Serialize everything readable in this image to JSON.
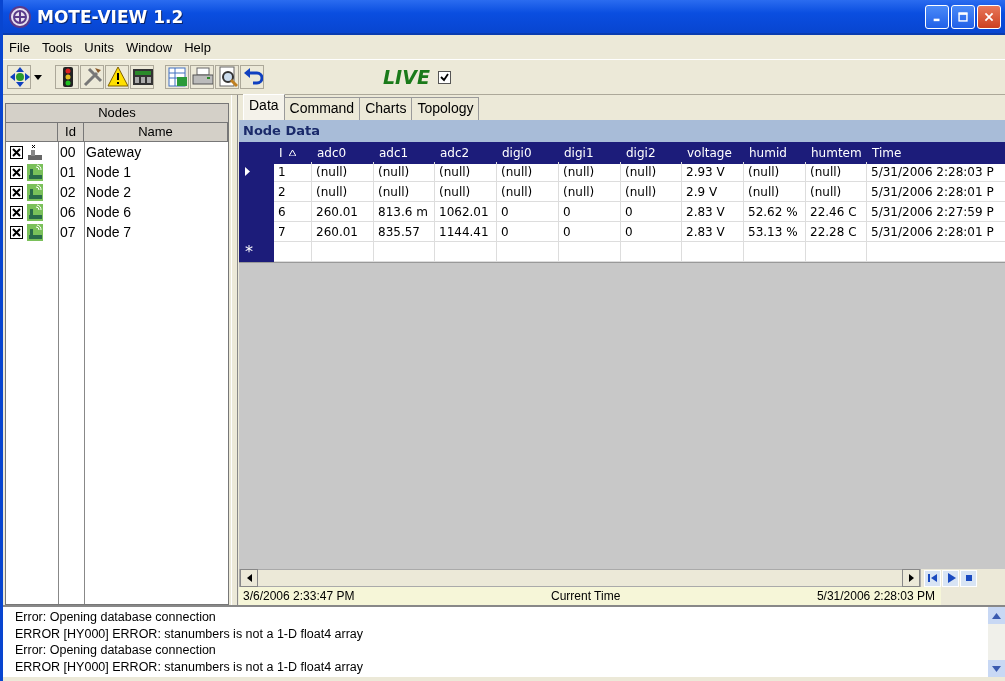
{
  "window": {
    "title": "MOTE-VIEW 1.2"
  },
  "menu": [
    "File",
    "Tools",
    "Units",
    "Window",
    "Help"
  ],
  "toolbar": {
    "live_label": "LIVE",
    "live_checked": true
  },
  "nodes": {
    "title": "Nodes",
    "columns": [
      "Id",
      "Name"
    ],
    "items": [
      {
        "id": "00",
        "name": "Gateway",
        "checked": true,
        "kind": "gateway"
      },
      {
        "id": "01",
        "name": "Node 1",
        "checked": true,
        "kind": "mote"
      },
      {
        "id": "02",
        "name": "Node 2",
        "checked": true,
        "kind": "mote"
      },
      {
        "id": "06",
        "name": "Node 6",
        "checked": true,
        "kind": "mote"
      },
      {
        "id": "07",
        "name": "Node 7",
        "checked": true,
        "kind": "mote"
      }
    ]
  },
  "tabs": [
    {
      "label": "Data",
      "selected": true
    },
    {
      "label": "Command",
      "selected": false
    },
    {
      "label": "Charts",
      "selected": false
    },
    {
      "label": "Topology",
      "selected": false
    }
  ],
  "grid": {
    "title": "Node Data",
    "columns": [
      "I",
      "adc0",
      "adc1",
      "adc2",
      "digi0",
      "digi1",
      "digi2",
      "voltage",
      "humid",
      "humtem",
      "Time"
    ],
    "rows": [
      {
        "current": true,
        "cells": [
          "1",
          "(null)",
          "(null)",
          "(null)",
          "(null)",
          "(null)",
          "(null)",
          "2.93 V",
          "(null)",
          "(null)",
          "5/31/2006 2:28:03 P"
        ]
      },
      {
        "current": false,
        "cells": [
          "2",
          "(null)",
          "(null)",
          "(null)",
          "(null)",
          "(null)",
          "(null)",
          "2.9 V",
          "(null)",
          "(null)",
          "5/31/2006 2:28:01 P"
        ]
      },
      {
        "current": false,
        "cells": [
          "6",
          "260.01",
          "813.6 m",
          "1062.01",
          "0",
          "0",
          "0",
          "2.83 V",
          "52.62 %",
          "22.46 C",
          "5/31/2006 2:27:59 P"
        ]
      },
      {
        "current": false,
        "cells": [
          "7",
          "260.01",
          "835.57",
          "1144.41",
          "0",
          "0",
          "0",
          "2.83 V",
          "53.13 %",
          "22.28 C",
          "5/31/2006 2:28:01 P"
        ]
      }
    ],
    "new_row_marker": "*"
  },
  "timeline": {
    "start": "3/6/2006 2:33:47 PM",
    "label": "Current Time",
    "end": "5/31/2006 2:28:03 PM"
  },
  "log": [
    "Error: Opening database connection",
    "ERROR [HY000] ERROR:  stanumbers is not a 1-D float4 array",
    "Error: Opening database connection",
    "ERROR [HY000] ERROR:  stanumbers is not a 1-D float4 array"
  ]
}
